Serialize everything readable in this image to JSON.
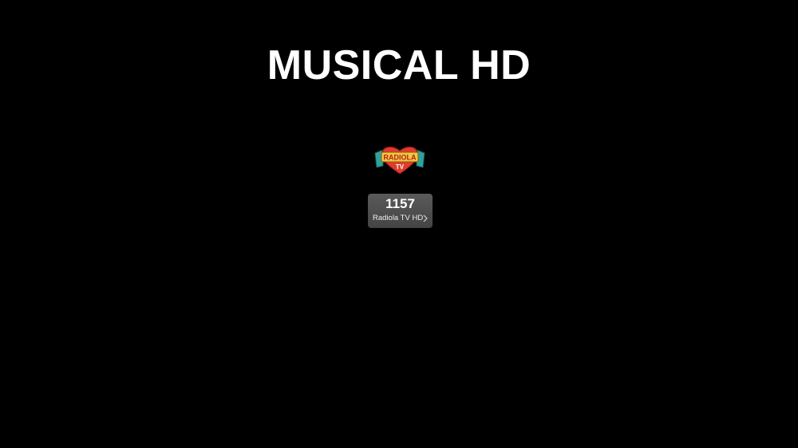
{
  "page": {
    "title": "MUSICAL HD",
    "background_color": "#000000"
  },
  "channels": [
    {
      "number": "1157",
      "name": "Radiola TV HD",
      "logo": {
        "icon": "radiola-tv-logo",
        "text_top": "RADIOLA",
        "text_bottom": "TV"
      },
      "card_color": "#4f4f4f"
    }
  ]
}
